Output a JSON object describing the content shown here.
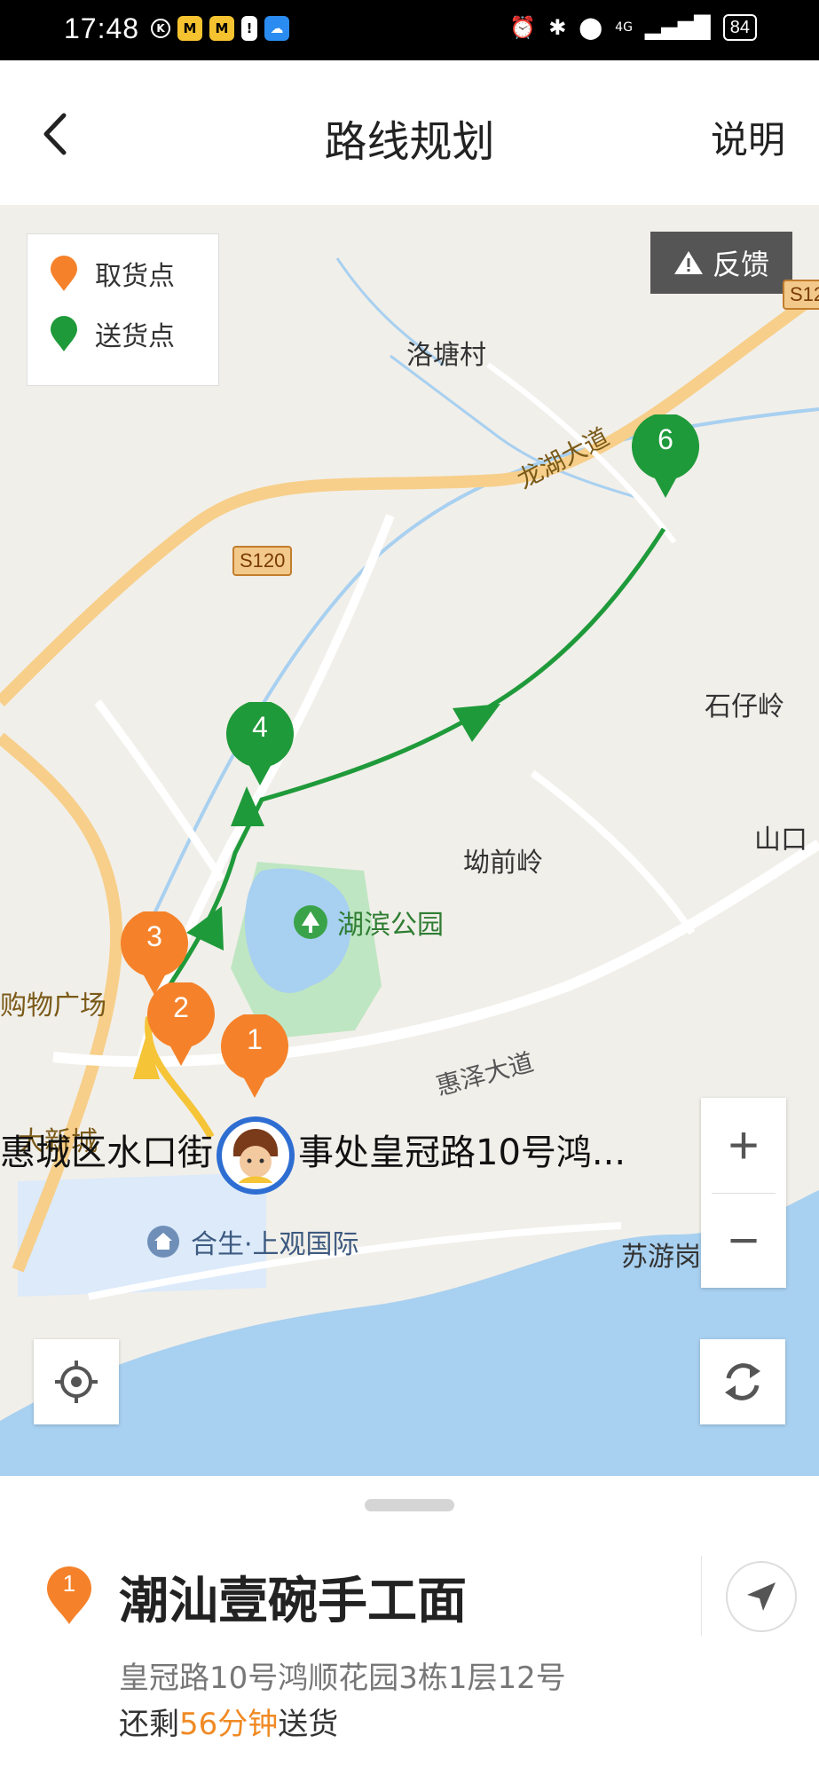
{
  "status_bar": {
    "time": "17:48",
    "battery": "84",
    "network": "4G"
  },
  "header": {
    "back_icon": "chevron-left-icon",
    "title": "路线规划",
    "help_label": "说明"
  },
  "map": {
    "legend": [
      {
        "label": "取货点",
        "color": "#f5822a"
      },
      {
        "label": "送货点",
        "color": "#1f9a3a"
      }
    ],
    "feedback_label": "反馈",
    "place_labels": {
      "luotang": "洛塘村",
      "shizailing": "石仔岭",
      "aoqianling": "坳前岭",
      "park": "湖滨公园",
      "shankou": "山口",
      "suyougang": "苏游岗",
      "mall": "购物广场",
      "daxincheng": "大新城",
      "community": "合生·上观国际"
    },
    "road_labels": {
      "longhu": "龙湖大道",
      "huize": "惠泽大道",
      "s120": "S120",
      "s120_edge": "S12"
    },
    "address_overlay": {
      "left": "惠城区水口街",
      "right": "事处皇冠路10号鸿..."
    },
    "markers": [
      {
        "number": "1",
        "kind": "pickup"
      },
      {
        "number": "2",
        "kind": "pickup"
      },
      {
        "number": "3",
        "kind": "pickup"
      },
      {
        "number": "4",
        "kind": "delivery"
      },
      {
        "number": "6",
        "kind": "delivery"
      }
    ],
    "zoom_in": "+",
    "zoom_out": "−",
    "colors": {
      "pickup": "#f5822a",
      "delivery": "#1f9a3a",
      "water": "#a8d0f0",
      "park": "#bfe6c2",
      "highway": "#f7cf8a"
    }
  },
  "sheet": {
    "marker_number": "1",
    "shop_name": "潮汕壹碗手工面",
    "address": "皇冠路10号鸿顺花园3栋1层12号",
    "delivery_prefix": "还剩",
    "delivery_time": "56分钟",
    "delivery_suffix": "送货"
  }
}
